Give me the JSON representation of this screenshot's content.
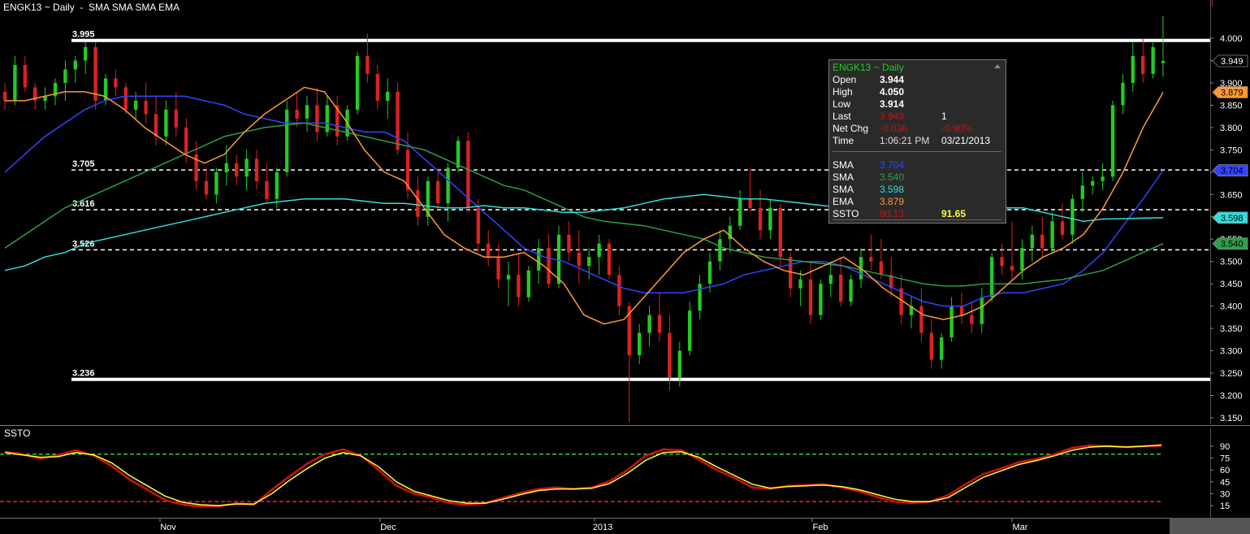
{
  "title": "ENGK13 ~ Daily  -  SMA SMA SMA EMA",
  "ssto_title": "SSTO",
  "colors": {
    "background": "#000000",
    "up": "#22cc22",
    "down": "#dd2222",
    "sma_blue": "#3344ff",
    "sma_green": "#2e9e4a",
    "sma_cyan": "#33dddd",
    "ema": "#ff9933",
    "stoch_k": "#cc1111",
    "stoch_d": "#ffff33"
  },
  "tooltip": {
    "header": "ENGK13 ~ Daily",
    "rows": [
      {
        "label": "Open",
        "value": "3.944",
        "extra": ""
      },
      {
        "label": "High",
        "value": "4.050",
        "extra": ""
      },
      {
        "label": "Low",
        "value": "3.914",
        "extra": ""
      },
      {
        "label": "Last",
        "value": "3.949",
        "extra": "1"
      },
      {
        "label": "Net Chg",
        "value": "-0.036",
        "extra": "-0.90%"
      },
      {
        "label": "Time",
        "value": "1:06:21 PM",
        "extra": "03/21/2013"
      }
    ],
    "studies": [
      {
        "label": "SMA",
        "value": "3.704",
        "color": "#3344ff",
        "extra": ""
      },
      {
        "label": "SMA",
        "value": "3.540",
        "color": "#2e9e4a",
        "extra": ""
      },
      {
        "label": "SMA",
        "value": "3.598",
        "color": "#33dddd",
        "extra": ""
      },
      {
        "label": "EMA",
        "value": "3.879",
        "color": "#ff9933",
        "extra": ""
      },
      {
        "label": "SSTO",
        "value": "90.13",
        "color": "#cc1111",
        "extra": "91.65"
      }
    ]
  },
  "price_axis": {
    "ticks": [
      "4.000",
      "3.950",
      "3.900",
      "3.850",
      "3.800",
      "3.750",
      "3.700",
      "3.650",
      "3.600",
      "3.550",
      "3.500",
      "3.450",
      "3.400",
      "3.350",
      "3.300",
      "3.250",
      "3.200",
      "3.150"
    ],
    "badges": [
      {
        "value": "3.949",
        "bg": "#000000",
        "fg": "#ffffff"
      },
      {
        "value": "3.879",
        "bg": "#ff9933",
        "fg": "#000000"
      },
      {
        "value": "3.704",
        "bg": "#3344ff",
        "fg": "#000000"
      },
      {
        "value": "3.598",
        "bg": "#33dddd",
        "fg": "#000000"
      },
      {
        "value": "3.540",
        "bg": "#2e9e4a",
        "fg": "#000000"
      }
    ]
  },
  "stoch_axis": {
    "ticks": [
      "90",
      "75",
      "60",
      "45",
      "30",
      "15"
    ]
  },
  "x_axis": {
    "labels": [
      "Nov",
      "Dec",
      "2013",
      "Feb",
      "Mar"
    ]
  },
  "chart_data": {
    "type": "candlestick",
    "title": "ENGK13 ~ Daily",
    "ylim": [
      3.13,
      4.05
    ],
    "levels": [
      {
        "label": "3.995",
        "value": 3.995,
        "style": "solid"
      },
      {
        "label": "3.705",
        "value": 3.705,
        "style": "dashed"
      },
      {
        "label": "3.616",
        "value": 3.616,
        "style": "dashed"
      },
      {
        "label": "3.526",
        "value": 3.526,
        "style": "dashed"
      },
      {
        "label": "3.236",
        "value": 3.236,
        "style": "solid"
      }
    ],
    "candles": [
      [
        3.88,
        3.9,
        3.84,
        3.86
      ],
      [
        3.86,
        3.96,
        3.85,
        3.94
      ],
      [
        3.94,
        3.96,
        3.88,
        3.89
      ],
      [
        3.89,
        3.9,
        3.84,
        3.86
      ],
      [
        3.86,
        3.89,
        3.84,
        3.87
      ],
      [
        3.87,
        3.91,
        3.85,
        3.9
      ],
      [
        3.9,
        3.95,
        3.86,
        3.93
      ],
      [
        3.93,
        3.96,
        3.9,
        3.95
      ],
      [
        3.95,
        3.99,
        3.92,
        3.98
      ],
      [
        3.98,
        3.99,
        3.84,
        3.86
      ],
      [
        3.86,
        3.92,
        3.85,
        3.91
      ],
      [
        3.91,
        3.93,
        3.87,
        3.89
      ],
      [
        3.89,
        3.9,
        3.83,
        3.84
      ],
      [
        3.84,
        3.88,
        3.82,
        3.86
      ],
      [
        3.86,
        3.9,
        3.81,
        3.83
      ],
      [
        3.83,
        3.87,
        3.76,
        3.78
      ],
      [
        3.78,
        3.86,
        3.76,
        3.84
      ],
      [
        3.84,
        3.88,
        3.78,
        3.8
      ],
      [
        3.8,
        3.82,
        3.72,
        3.74
      ],
      [
        3.74,
        3.77,
        3.66,
        3.68
      ],
      [
        3.68,
        3.71,
        3.64,
        3.65
      ],
      [
        3.65,
        3.71,
        3.63,
        3.7
      ],
      [
        3.7,
        3.76,
        3.67,
        3.72
      ],
      [
        3.72,
        3.74,
        3.67,
        3.69
      ],
      [
        3.69,
        3.75,
        3.66,
        3.73
      ],
      [
        3.73,
        3.75,
        3.66,
        3.68
      ],
      [
        3.68,
        3.72,
        3.63,
        3.64
      ],
      [
        3.64,
        3.71,
        3.62,
        3.7
      ],
      [
        3.7,
        3.86,
        3.69,
        3.84
      ],
      [
        3.84,
        3.88,
        3.8,
        3.82
      ],
      [
        3.82,
        3.87,
        3.79,
        3.85
      ],
      [
        3.85,
        3.89,
        3.77,
        3.79
      ],
      [
        3.79,
        3.87,
        3.78,
        3.85
      ],
      [
        3.85,
        3.87,
        3.76,
        3.78
      ],
      [
        3.78,
        3.85,
        3.77,
        3.84
      ],
      [
        3.84,
        3.97,
        3.83,
        3.96
      ],
      [
        3.96,
        4.01,
        3.9,
        3.92
      ],
      [
        3.92,
        3.94,
        3.84,
        3.86
      ],
      [
        3.86,
        3.91,
        3.82,
        3.88
      ],
      [
        3.88,
        3.9,
        3.74,
        3.75
      ],
      [
        3.75,
        3.79,
        3.64,
        3.66
      ],
      [
        3.66,
        3.69,
        3.58,
        3.6
      ],
      [
        3.6,
        3.69,
        3.58,
        3.68
      ],
      [
        3.68,
        3.71,
        3.62,
        3.63
      ],
      [
        3.63,
        3.72,
        3.59,
        3.71
      ],
      [
        3.71,
        3.78,
        3.7,
        3.77
      ],
      [
        3.77,
        3.79,
        3.61,
        3.62
      ],
      [
        3.62,
        3.64,
        3.52,
        3.54
      ],
      [
        3.54,
        3.57,
        3.49,
        3.51
      ],
      [
        3.51,
        3.54,
        3.44,
        3.46
      ],
      [
        3.46,
        3.5,
        3.4,
        3.47
      ],
      [
        3.47,
        3.52,
        3.4,
        3.42
      ],
      [
        3.42,
        3.49,
        3.41,
        3.48
      ],
      [
        3.48,
        3.55,
        3.45,
        3.53
      ],
      [
        3.53,
        3.56,
        3.44,
        3.45
      ],
      [
        3.45,
        3.58,
        3.44,
        3.56
      ],
      [
        3.56,
        3.59,
        3.5,
        3.52
      ],
      [
        3.52,
        3.57,
        3.45,
        3.49
      ],
      [
        3.49,
        3.53,
        3.46,
        3.51
      ],
      [
        3.51,
        3.56,
        3.47,
        3.54
      ],
      [
        3.54,
        3.55,
        3.46,
        3.47
      ],
      [
        3.47,
        3.49,
        3.38,
        3.4
      ],
      [
        3.4,
        3.41,
        3.14,
        3.29
      ],
      [
        3.29,
        3.36,
        3.27,
        3.34
      ],
      [
        3.34,
        3.4,
        3.31,
        3.38
      ],
      [
        3.38,
        3.43,
        3.32,
        3.34
      ],
      [
        3.34,
        3.38,
        3.21,
        3.24
      ],
      [
        3.24,
        3.32,
        3.22,
        3.3
      ],
      [
        3.3,
        3.41,
        3.29,
        3.39
      ],
      [
        3.39,
        3.47,
        3.37,
        3.45
      ],
      [
        3.45,
        3.52,
        3.43,
        3.5
      ],
      [
        3.5,
        3.57,
        3.48,
        3.55
      ],
      [
        3.55,
        3.6,
        3.52,
        3.58
      ],
      [
        3.58,
        3.66,
        3.57,
        3.64
      ],
      [
        3.64,
        3.71,
        3.61,
        3.62
      ],
      [
        3.62,
        3.66,
        3.55,
        3.57
      ],
      [
        3.57,
        3.64,
        3.55,
        3.62
      ],
      [
        3.62,
        3.63,
        3.49,
        3.51
      ],
      [
        3.51,
        3.52,
        3.42,
        3.44
      ],
      [
        3.44,
        3.48,
        3.4,
        3.46
      ],
      [
        3.46,
        3.5,
        3.36,
        3.38
      ],
      [
        3.38,
        3.46,
        3.37,
        3.45
      ],
      [
        3.45,
        3.5,
        3.42,
        3.47
      ],
      [
        3.47,
        3.51,
        3.4,
        3.41
      ],
      [
        3.41,
        3.47,
        3.4,
        3.46
      ],
      [
        3.46,
        3.53,
        3.44,
        3.51
      ],
      [
        3.51,
        3.56,
        3.48,
        3.5
      ],
      [
        3.5,
        3.55,
        3.46,
        3.47
      ],
      [
        3.47,
        3.51,
        3.42,
        3.44
      ],
      [
        3.44,
        3.47,
        3.36,
        3.38
      ],
      [
        3.38,
        3.42,
        3.35,
        3.4
      ],
      [
        3.4,
        3.44,
        3.32,
        3.34
      ],
      [
        3.34,
        3.37,
        3.26,
        3.28
      ],
      [
        3.28,
        3.34,
        3.26,
        3.33
      ],
      [
        3.33,
        3.42,
        3.32,
        3.4
      ],
      [
        3.4,
        3.43,
        3.36,
        3.38
      ],
      [
        3.38,
        3.41,
        3.34,
        3.36
      ],
      [
        3.36,
        3.44,
        3.34,
        3.42
      ],
      [
        3.42,
        3.52,
        3.41,
        3.51
      ],
      [
        3.51,
        3.54,
        3.47,
        3.49
      ],
      [
        3.49,
        3.59,
        3.46,
        3.48
      ],
      [
        3.48,
        3.55,
        3.46,
        3.53
      ],
      [
        3.53,
        3.58,
        3.5,
        3.56
      ],
      [
        3.56,
        3.6,
        3.51,
        3.53
      ],
      [
        3.53,
        3.61,
        3.52,
        3.59
      ],
      [
        3.59,
        3.63,
        3.55,
        3.56
      ],
      [
        3.56,
        3.65,
        3.54,
        3.64
      ],
      [
        3.64,
        3.7,
        3.61,
        3.67
      ],
      [
        3.67,
        3.69,
        3.65,
        3.68
      ],
      [
        3.68,
        3.72,
        3.66,
        3.69
      ],
      [
        3.69,
        3.86,
        3.68,
        3.85
      ],
      [
        3.85,
        3.92,
        3.83,
        3.9
      ],
      [
        3.9,
        3.99,
        3.88,
        3.96
      ],
      [
        3.96,
        4.0,
        3.9,
        3.92
      ],
      [
        3.92,
        3.99,
        3.91,
        3.98
      ],
      [
        3.944,
        4.05,
        3.914,
        3.949
      ]
    ],
    "series": [
      {
        "name": "SMA",
        "value": 3.704,
        "values": [
          3.7,
          3.74,
          3.78,
          3.81,
          3.84,
          3.86,
          3.87,
          3.87,
          3.87,
          3.87,
          3.86,
          3.85,
          3.83,
          3.82,
          3.81,
          3.81,
          3.81,
          3.8,
          3.79,
          3.79,
          3.77,
          3.73,
          3.69,
          3.65,
          3.61,
          3.57,
          3.53,
          3.51,
          3.5,
          3.48,
          3.46,
          3.44,
          3.43,
          3.43,
          3.43,
          3.44,
          3.45,
          3.47,
          3.48,
          3.49,
          3.5,
          3.5,
          3.49,
          3.47,
          3.45,
          3.43,
          3.41,
          3.4,
          3.4,
          3.42,
          3.43,
          3.43,
          3.44,
          3.45,
          3.48,
          3.52,
          3.58,
          3.64,
          3.704
        ]
      },
      {
        "name": "SMA",
        "value": 3.54,
        "values": [
          3.53,
          3.56,
          3.59,
          3.62,
          3.64,
          3.66,
          3.68,
          3.7,
          3.72,
          3.74,
          3.76,
          3.78,
          3.79,
          3.8,
          3.805,
          3.81,
          3.8,
          3.79,
          3.78,
          3.77,
          3.76,
          3.75,
          3.73,
          3.71,
          3.69,
          3.67,
          3.66,
          3.64,
          3.62,
          3.6,
          3.59,
          3.585,
          3.58,
          3.57,
          3.56,
          3.55,
          3.53,
          3.52,
          3.51,
          3.505,
          3.5,
          3.495,
          3.49,
          3.48,
          3.47,
          3.46,
          3.45,
          3.445,
          3.445,
          3.45,
          3.45,
          3.45,
          3.455,
          3.46,
          3.47,
          3.48,
          3.5,
          3.52,
          3.54
        ]
      },
      {
        "name": "SMA",
        "value": 3.598,
        "values": [
          3.48,
          3.49,
          3.51,
          3.52,
          3.54,
          3.55,
          3.56,
          3.57,
          3.58,
          3.59,
          3.6,
          3.61,
          3.62,
          3.63,
          3.635,
          3.64,
          3.64,
          3.64,
          3.635,
          3.63,
          3.63,
          3.625,
          3.62,
          3.62,
          3.625,
          3.62,
          3.62,
          3.615,
          3.61,
          3.61,
          3.615,
          3.62,
          3.63,
          3.64,
          3.645,
          3.65,
          3.645,
          3.64,
          3.64,
          3.635,
          3.63,
          3.625,
          3.62,
          3.62,
          3.615,
          3.61,
          3.61,
          3.61,
          3.61,
          3.615,
          3.62,
          3.62,
          3.61,
          3.6,
          3.59,
          3.595,
          3.596,
          3.597,
          3.598
        ]
      },
      {
        "name": "EMA",
        "value": 3.879,
        "values": [
          3.86,
          3.86,
          3.87,
          3.88,
          3.88,
          3.87,
          3.84,
          3.8,
          3.77,
          3.74,
          3.72,
          3.74,
          3.79,
          3.83,
          3.86,
          3.89,
          3.88,
          3.82,
          3.75,
          3.7,
          3.68,
          3.62,
          3.56,
          3.53,
          3.51,
          3.51,
          3.52,
          3.49,
          3.45,
          3.38,
          3.36,
          3.37,
          3.42,
          3.47,
          3.52,
          3.55,
          3.57,
          3.53,
          3.5,
          3.48,
          3.47,
          3.49,
          3.51,
          3.48,
          3.44,
          3.41,
          3.38,
          3.37,
          3.38,
          3.4,
          3.44,
          3.48,
          3.51,
          3.53,
          3.56,
          3.62,
          3.7,
          3.8,
          3.879
        ]
      }
    ],
    "stochastic": {
      "ylim": [
        10,
        95
      ],
      "levels": [
        80,
        20
      ],
      "k": [
        83,
        80,
        74,
        79,
        85,
        78,
        65,
        48,
        35,
        22,
        16,
        14,
        14,
        18,
        16,
        35,
        52,
        68,
        80,
        86,
        78,
        60,
        40,
        30,
        25,
        18,
        16,
        18,
        25,
        31,
        36,
        38,
        36,
        38,
        46,
        60,
        78,
        86,
        85,
        73,
        60,
        50,
        38,
        36,
        40,
        41,
        42,
        38,
        33,
        26,
        20,
        18,
        20,
        28,
        42,
        55,
        62,
        70,
        74,
        80,
        88,
        91,
        90,
        89,
        90,
        90.13
      ],
      "d": [
        82,
        79,
        76,
        77,
        82,
        79,
        69,
        53,
        40,
        27,
        19,
        16,
        15,
        17,
        17,
        30,
        47,
        62,
        75,
        82,
        78,
        64,
        45,
        33,
        27,
        21,
        18,
        18,
        23,
        29,
        34,
        36,
        36,
        37,
        43,
        56,
        72,
        82,
        83,
        76,
        64,
        53,
        42,
        37,
        39,
        40,
        41,
        39,
        35,
        29,
        23,
        20,
        20,
        25,
        38,
        51,
        59,
        67,
        72,
        78,
        85,
        89,
        90,
        89,
        90,
        91.65
      ]
    }
  }
}
